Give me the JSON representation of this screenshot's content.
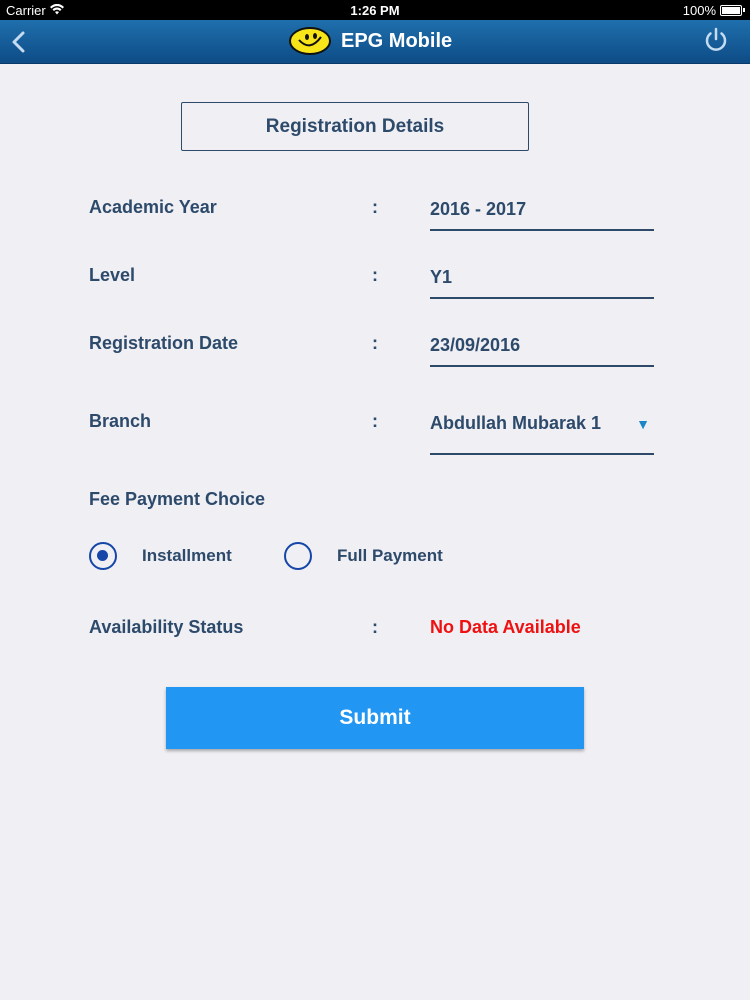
{
  "status_bar": {
    "carrier": "Carrier",
    "time": "1:26 PM",
    "battery": "100%"
  },
  "nav": {
    "title": "EPG Mobile",
    "back_icon": "chevron-left-icon",
    "logo_icon": "smiley-logo",
    "power_icon": "power-icon"
  },
  "form": {
    "header": "Registration Details",
    "academic_year": {
      "label": "Academic Year",
      "value": "2016 - 2017"
    },
    "level": {
      "label": "Level",
      "value": "Y1"
    },
    "registration_date": {
      "label": "Registration Date",
      "value": "23/09/2016"
    },
    "branch": {
      "label": "Branch",
      "value": "Abdullah Mubarak 1"
    },
    "fee_payment": {
      "label": "Fee Payment Choice",
      "options": [
        {
          "label": "Installment",
          "selected": true
        },
        {
          "label": "Full Payment",
          "selected": false
        }
      ]
    },
    "availability": {
      "label": "Availability Status",
      "value": "No Data Available"
    },
    "colon": ":",
    "submit_label": "Submit"
  },
  "colors": {
    "nav_bg": "#155d9b",
    "label": "#2d4a6b",
    "radio": "#1546a8",
    "error": "#ee1111",
    "button": "#2196f3"
  }
}
